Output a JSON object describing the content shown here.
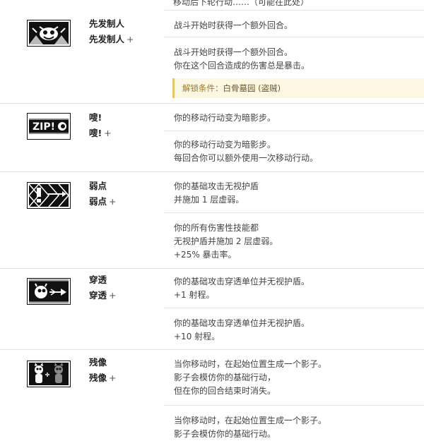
{
  "top_cut_text": "移动后下轮行动……（可能在此处）",
  "skills": [
    {
      "icon": "ambush-icon",
      "name": "先发制人",
      "name_plus": "先发制人",
      "base": [
        "战斗开始时获得一个额外回合。"
      ],
      "upgraded": [
        "战斗开始时获得一个额外回合。",
        "你在这个回合造成的伤害总是暴击。"
      ],
      "unlock_label": "解锁条件：",
      "unlock_value": "白骨墓园 (盗贼)"
    },
    {
      "icon": "zip-icon",
      "name": "嗖!",
      "name_plus": "嗖!",
      "base": [
        "你的移动行动变为暗影步。"
      ],
      "upgraded": [
        "你的移动行动变为暗影步。",
        "每回合你可以额外使用一次移动行动。"
      ]
    },
    {
      "icon": "weakspot-icon",
      "name": "弱点",
      "name_plus": "弱点",
      "base": [
        "你的基础攻击无视护盾",
        "并施加 1 层虚弱。"
      ],
      "upgraded": [
        "你的所有伤害性技能都",
        "无视护盾并施加 2 层虚弱。",
        "+25% 暴击率。"
      ]
    },
    {
      "icon": "pierce-icon",
      "name": "穿透",
      "name_plus": "穿透",
      "base": [
        "你的基础攻击穿透单位并无视护盾。",
        "+1 射程。"
      ],
      "upgraded": [
        "你的基础攻击穿透单位并无视护盾。",
        "+10 射程。"
      ]
    },
    {
      "icon": "afterimage-icon",
      "name": "残像",
      "name_plus": "残像",
      "base": [
        "当你移动时，在起始位置生成一个影子。",
        "影子会模仿你的基础行动，",
        "但在你的回合结束时消失。"
      ],
      "upgraded": [
        "当你移动时，在起始位置生成一个影子。",
        "影子会模仿你的基础行动。"
      ]
    }
  ],
  "plus_sign": "+"
}
